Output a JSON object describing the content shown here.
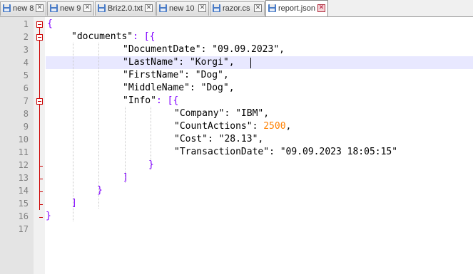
{
  "tabs": [
    {
      "label": "new 8",
      "active": false,
      "icon": "floppy-disk-icon",
      "color": "#4a7cc7"
    },
    {
      "label": "new 9",
      "active": false,
      "icon": "floppy-disk-icon",
      "color": "#4a7cc7"
    },
    {
      "label": "Briz2.0.txt",
      "active": false,
      "icon": "floppy-disk-icon",
      "color": "#4a7cc7"
    },
    {
      "label": "new 10",
      "active": false,
      "icon": "floppy-disk-icon",
      "color": "#4a7cc7"
    },
    {
      "label": "razor.cs",
      "active": false,
      "icon": "floppy-disk-icon",
      "color": "#4a7cc7"
    },
    {
      "label": "report.json",
      "active": true,
      "icon": "floppy-disk-icon",
      "color": "#4a7cc7"
    }
  ],
  "close_glyph": "✕",
  "editor": {
    "line_numbers": [
      "1",
      "2",
      "3",
      "4",
      "5",
      "6",
      "7",
      "8",
      "9",
      "10",
      "11",
      "12",
      "13",
      "14",
      "15",
      "16",
      "17"
    ],
    "lines": [
      {
        "text": "{"
      },
      {
        "key": "\"documents\"",
        "after": ": [{"
      },
      {
        "key": "\"DocumentDate\"",
        "sep": ": ",
        "value": "\"09.09.2023\"",
        "end": ","
      },
      {
        "key": "\"LastName\"",
        "sep": ": ",
        "value": "\"Korgi\"",
        "end": ","
      },
      {
        "key": "\"FirstName\"",
        "sep": ": ",
        "value": "\"Dog\"",
        "end": ","
      },
      {
        "key": "\"MiddleName\"",
        "sep": ": ",
        "value": "\"Dog\"",
        "end": ","
      },
      {
        "key": "\"Info\"",
        "after": ": [{"
      },
      {
        "key": "\"Company\"",
        "sep": ": ",
        "value": "\"IBM\"",
        "end": ","
      },
      {
        "key": "\"CountActions\"",
        "sep": ": ",
        "value": "2500",
        "end": ","
      },
      {
        "key": "\"Cost\"",
        "sep": ": ",
        "value": "\"28.13\"",
        "end": ","
      },
      {
        "key": "\"TransactionDate\"",
        "sep": ": ",
        "value": "\"09.09.2023 18:05:15\"",
        "end": ""
      },
      {
        "text": "}"
      },
      {
        "text": "]"
      },
      {
        "text": "}"
      },
      {
        "text": "]"
      },
      {
        "text": "}"
      },
      {
        "text": ""
      }
    ],
    "current_line": "4",
    "colors": {
      "brace": "#8000ff",
      "number": "#ff8000",
      "current_line_bg": "#e8e8ff",
      "fold_marker": "#cc0000"
    }
  }
}
